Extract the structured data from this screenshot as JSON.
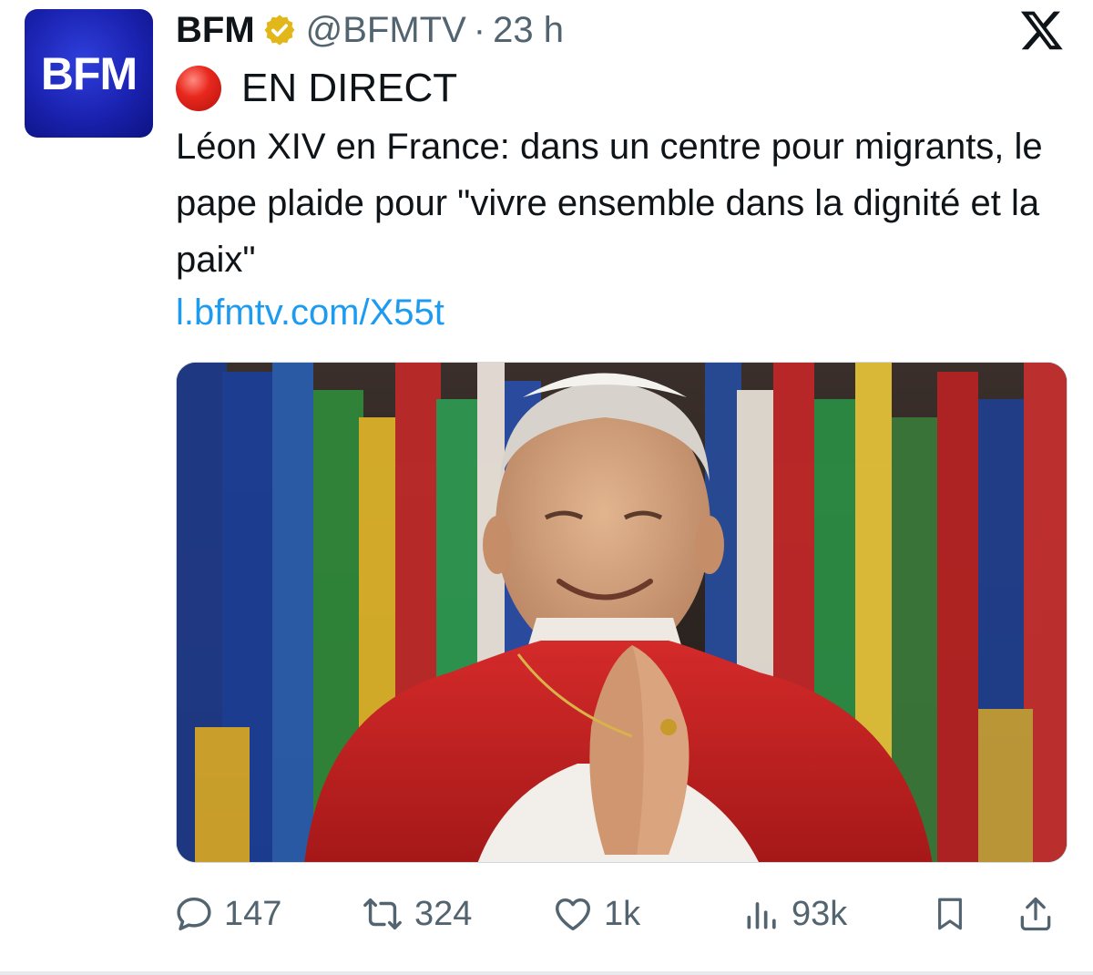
{
  "account": {
    "avatar_text": "BFM",
    "name": "BFM",
    "handle": "@BFMTV",
    "separator": "·",
    "time": "23 h"
  },
  "tweet": {
    "live_label": "EN DIRECT",
    "text": "Léon XIV en France: dans un centre pour migrants, le pape plaide pour \"vivre ensemble dans la dignité et la paix\"",
    "link": "l.bfmtv.com/X55t"
  },
  "actions": {
    "replies": "147",
    "retweets": "324",
    "likes": "1k",
    "views": "93k"
  },
  "colors": {
    "accent_link": "#1d9bf0",
    "secondary_text": "#536471",
    "avatar_blue": "#1a22b0",
    "verified_gold": "#e2b719",
    "live_red": "#e8281e"
  },
  "icons": [
    "verified-badge-icon",
    "x-logo-icon",
    "live-red-circle-icon",
    "reply-icon",
    "retweet-icon",
    "like-icon",
    "views-icon",
    "bookmark-icon",
    "share-icon"
  ]
}
